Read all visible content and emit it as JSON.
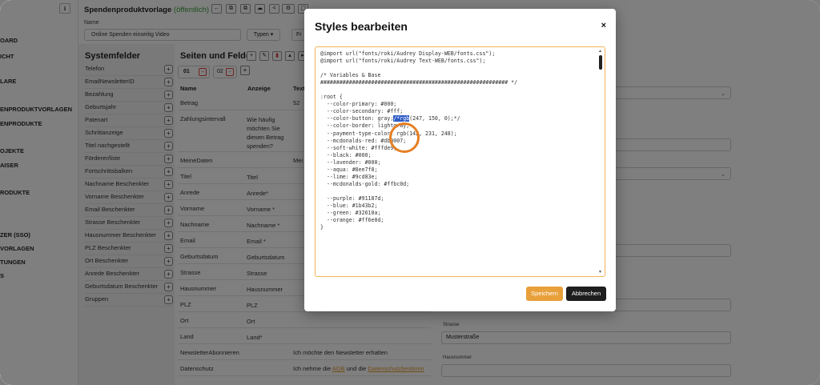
{
  "nav": {
    "collapse_icon": "⭳",
    "items": [
      {
        "label": "OARD"
      },
      {
        "label": "ICHT"
      },
      {
        "label": "LARE"
      },
      {
        "label": "ENPRODUKTVORLAGEN"
      },
      {
        "label": "ENPRODUKTE"
      },
      {
        "label": "OJEKTE"
      },
      {
        "label": "AISER"
      },
      {
        "label": "RODUKTE"
      },
      {
        "label": "ZER (SSO)"
      },
      {
        "label": "VORLAGEN"
      },
      {
        "label": "TUNGEN"
      },
      {
        "label": "S"
      }
    ]
  },
  "header": {
    "title": "Spendenproduktvorlage",
    "status": "(öffentlich)",
    "name_label": "Name",
    "name_value": "Online Spenden einseitig Video",
    "typen_label": "Typen",
    "fr_label": "Fr"
  },
  "systemfelder": {
    "title": "Systemfelder",
    "items": [
      "Telefon",
      "EmailNewsletterID",
      "Bezahlung",
      "Geburtsjahr",
      "Patenart",
      "Schrittanzeige",
      "Titel nachgestellt",
      "Förderer/liste",
      "Fortschrittsbalken",
      "Nachname Beschenkter",
      "Vorname Beschenkter",
      "Email Beschenkter",
      "Strasse Beschenkter",
      "Hausnummer Beschenkter",
      "PLZ Beschenkter",
      "Ort Beschenkter",
      "Anrede Beschenkter",
      "Geburtsdatum Beschenkter",
      "Gruppen"
    ]
  },
  "fields": {
    "title": "Seiten und Felder",
    "tab1": "01",
    "tab2": "02",
    "headers": [
      "Name",
      "Anzeige",
      "Text"
    ],
    "rows": [
      {
        "name": "Betrag",
        "anzeige": "",
        "text": "52"
      },
      {
        "name": "Zahlungsintervall",
        "anzeige": "Wie häufig möchten Sie diesen Betrag spenden?",
        "text": ""
      },
      {
        "name": "MeineDaten",
        "anzeige": "",
        "text": "Mei"
      },
      {
        "name": "Titel",
        "anzeige": "Titel",
        "text": ""
      },
      {
        "name": "Anrede",
        "anzeige": "Anrede*",
        "text": ""
      },
      {
        "name": "Vorname",
        "anzeige": "Vorname *",
        "text": ""
      },
      {
        "name": "Nachname",
        "anzeige": "Nachname *",
        "text": ""
      },
      {
        "name": "Email",
        "anzeige": "Email *",
        "text": ""
      },
      {
        "name": "Geburtsdatum",
        "anzeige": "Geburtsdatum",
        "text": ""
      },
      {
        "name": "Strasse",
        "anzeige": "Strasse",
        "text": ""
      },
      {
        "name": "Hausnummer",
        "anzeige": "Hausnummer",
        "text": ""
      },
      {
        "name": "PLZ",
        "anzeige": "PLZ",
        "text": ""
      },
      {
        "name": "Ort",
        "anzeige": "Ort",
        "text": ""
      },
      {
        "name": "Land",
        "anzeige": "Land*",
        "text": ""
      },
      {
        "name": "NewsletterAbonnieren",
        "anzeige": "",
        "text": "Ich möchte den Newsletter erhalten"
      },
      {
        "name": "Datenschutz",
        "anzeige": "",
        "text": ""
      }
    ],
    "datenschutz": {
      "before": "Ich nehme die ",
      "link1": "AGB",
      "middle": " und die ",
      "link2": "Datenschutzbestimm"
    }
  },
  "right_pane": {
    "strasse_label": "Strasse",
    "strasse_value": "Musterstraße",
    "hausnummer_label": "Hausnummer"
  },
  "modal": {
    "title": "Styles bearbeiten",
    "close": "×",
    "code_lines": [
      "@import url(\"fonts/roki/Audrey Display-WEB/fonts.css\");",
      "@import url(\"fonts/roki/Audrey Text-WEB/fonts.css\");",
      "",
      "/* Variables & Base",
      "########################################################### */",
      "",
      ":root {",
      "  --color-primary: #000;",
      "  --color-secondary: #fff;",
      "  --color-button: gray;/*rgb(247, 150, 0);*/",
      "  --color-border: lightgray;",
      "  --payment-type-color: rgb(142, 231, 248);",
      "  --mcdonalds-red: #db0007;",
      "  --soft-white: #fffde9;",
      "  --black: #000;",
      "  --lavender: #000;",
      "  --aqua: #8ee7f8;",
      "  --lime: #9cd83e;",
      "  --mcdonalds-gold: #ffbc0d;",
      "",
      "  --purple: #91187d;",
      "  --blue: #1b43b2;",
      "  --green: #32610a;",
      "  --orange: #ff6e0d;",
      "}"
    ],
    "selected_text": "/*rgb",
    "save_label": "Speichern",
    "cancel_label": "Abbrechen"
  },
  "colors": {
    "accent": "#e8a03a",
    "public_status": "#3a9b3a",
    "selection": "#2f5cc5",
    "cursor_highlight": "#e67e22"
  }
}
